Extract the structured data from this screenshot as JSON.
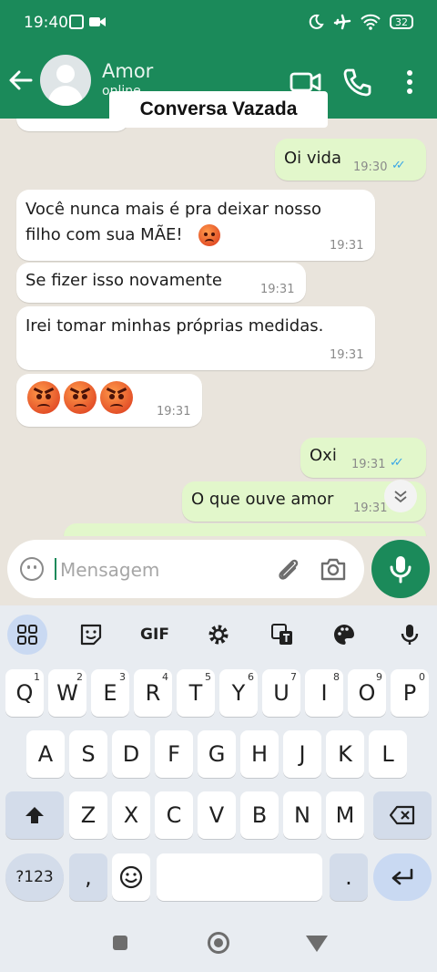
{
  "status_bar": {
    "time": "19:40",
    "battery": "32"
  },
  "header": {
    "contact_name": "Amor",
    "contact_status": "online"
  },
  "overlay": {
    "banner": "Conversa Vazada"
  },
  "messages": [
    {
      "text": "Oi vida",
      "time": "19:30",
      "direction": "out",
      "read": true
    },
    {
      "line1": "Você nunca mais é pra deixar nosso",
      "line2": "filho com sua MÃE!",
      "emoji": "pouting-face",
      "time": "19:31",
      "direction": "in"
    },
    {
      "text": "Se fizer isso novamente",
      "time": "19:31",
      "direction": "in"
    },
    {
      "text": "Irei tomar minhas próprias medidas.",
      "time": "19:31",
      "direction": "in"
    },
    {
      "emoji": "three-pouting-faces",
      "time": "19:31",
      "direction": "in"
    },
    {
      "text": "Oxi",
      "time": "19:31",
      "direction": "out",
      "read": true
    },
    {
      "text": "O que ouve amor",
      "time": "19:31",
      "direction": "out"
    }
  ],
  "composer": {
    "placeholder": "Mensagem"
  },
  "keyboard": {
    "toolbar": {
      "gif": "GIF"
    },
    "row1": [
      {
        "key": "Q",
        "num": "1"
      },
      {
        "key": "W",
        "num": "2"
      },
      {
        "key": "E",
        "num": "3"
      },
      {
        "key": "R",
        "num": "4"
      },
      {
        "key": "T",
        "num": "5"
      },
      {
        "key": "Y",
        "num": "6"
      },
      {
        "key": "U",
        "num": "7"
      },
      {
        "key": "I",
        "num": "8"
      },
      {
        "key": "O",
        "num": "9"
      },
      {
        "key": "P",
        "num": "0"
      }
    ],
    "row2": [
      "A",
      "S",
      "D",
      "F",
      "G",
      "H",
      "J",
      "K",
      "L"
    ],
    "row3": [
      "Z",
      "X",
      "C",
      "V",
      "B",
      "N",
      "M"
    ],
    "symbols_key": "?123",
    "comma_key": ",",
    "period_key": "."
  },
  "colors": {
    "header": "#1b8a5a",
    "outgoing": "#e2f7cb",
    "incoming": "#ffffff",
    "chat_bg": "#e9e4dc",
    "tick": "#3aa6e6"
  }
}
